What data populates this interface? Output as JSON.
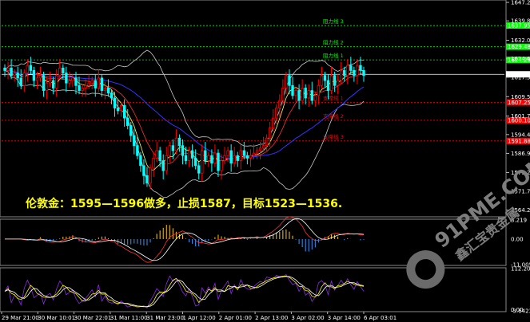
{
  "chart_data": {
    "type": "candlestick",
    "price_axis": {
      "ylim": [
        1562.2,
        1647.2
      ],
      "ticks": [
        "1647.20",
        "1639.83",
        "1632.05",
        "1624.68",
        "1617.30",
        "1609.55",
        "1601.78",
        "1594.40",
        "1586.90",
        "1579.25",
        "1571.75",
        "1564.25"
      ]
    },
    "time_axis": {
      "labels": [
        "29 Mar 21:00",
        "30 Mar 10:01",
        "30 Mar 22:01",
        "31 Mar 11:00",
        "31 Mar 23:00",
        "1 Apr 12:00",
        "2 Apr 01:00",
        "2 Apr 13:00",
        "3 Apr 02:00",
        "3 Apr 14:00",
        "6 Apr 03:01"
      ]
    },
    "levels": [
      {
        "label": "阻力线 3",
        "value": 1637.95,
        "tag": "1637.95",
        "color": "#00ff00"
      },
      {
        "label": "阻力线 2",
        "value": 1629.48,
        "tag": "1629.48",
        "color": "#00ff00"
      },
      {
        "label": "阻力线 1",
        "value": 1624.25,
        "tag": "1624.25",
        "color": "#00ff00"
      },
      {
        "label": "支撑线 1",
        "value": 1607.25,
        "tag": "1607.25",
        "color": "#ff0000"
      },
      {
        "label": "支撑线 2",
        "value": 1600.1,
        "tag": "1600.10",
        "color": "#ff0000"
      },
      {
        "label": "支撑线 3",
        "value": 1591.88,
        "tag": "1591.88",
        "color": "#ff0000"
      }
    ],
    "current_price": {
      "value": 1618.47,
      "tag": "1618.47"
    },
    "candles_close": [
      1620,
      1621,
      1618,
      1619,
      1617,
      1614,
      1619,
      1622,
      1620,
      1616,
      1617,
      1618,
      1612,
      1615,
      1616,
      1613,
      1618,
      1621,
      1619,
      1615,
      1616,
      1617,
      1614,
      1612,
      1613,
      1614,
      1615,
      1616,
      1613,
      1617,
      1612,
      1613,
      1611,
      1609,
      1605,
      1604,
      1606,
      1601,
      1598,
      1594,
      1590,
      1586,
      1582,
      1578,
      1575,
      1581,
      1585,
      1588,
      1584,
      1580,
      1586,
      1590,
      1588,
      1593,
      1590,
      1586,
      1584,
      1588,
      1585,
      1582,
      1579,
      1588,
      1584,
      1586,
      1583,
      1587,
      1580,
      1584,
      1586,
      1588,
      1583,
      1586,
      1584,
      1588,
      1586,
      1585,
      1586,
      1587,
      1588,
      1589,
      1590,
      1593,
      1597,
      1601,
      1605,
      1608,
      1613,
      1618,
      1614,
      1610,
      1612,
      1608,
      1613,
      1609,
      1612,
      1608,
      1610,
      1614,
      1618,
      1616,
      1612,
      1618,
      1614,
      1616,
      1620,
      1618,
      1622,
      1620,
      1618,
      1622,
      1620,
      1618
    ],
    "indicator1": {
      "ticks": [
        "8.219",
        "0.00",
        "-11.005"
      ]
    },
    "indicator2": {
      "ticks": [
        "112.2086",
        "0.00",
        "-3.6423"
      ]
    },
    "annotation": "伦敦金：1595—1596做多，止损1587，目标1523—1536."
  },
  "watermark": {
    "domain": "91PME.COM",
    "name": "鑫汇宝贵金属"
  },
  "colors": {
    "bull": "#ff0000",
    "bear": "#00ffff",
    "support": "#ff0000",
    "resistance": "#00ff00",
    "price_line": "#ffffff"
  }
}
